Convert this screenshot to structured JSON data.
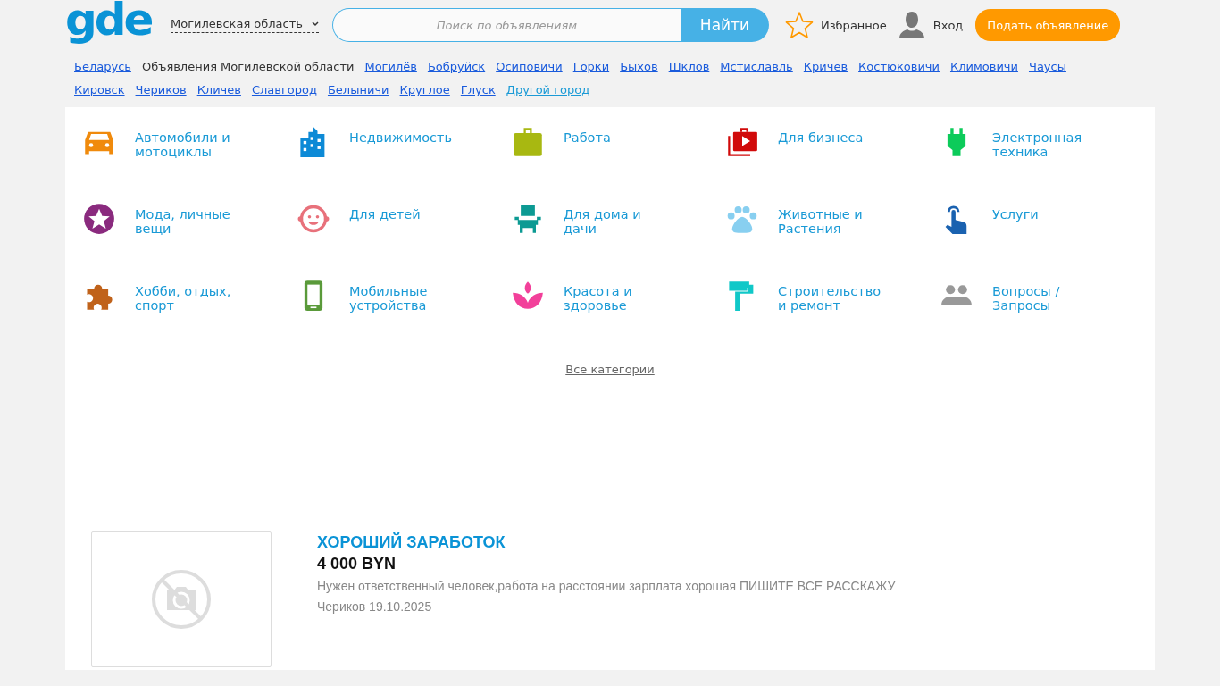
{
  "header": {
    "logo": "gde",
    "region": "Могилевская область",
    "search": {
      "placeholder": "Поиск по объявлениям",
      "button": "Найти"
    },
    "favorites": "Избранное",
    "login": "Вход",
    "post_button": "Подать объявление"
  },
  "breadcrumbs": [
    {
      "label": "Беларусь",
      "kind": "link"
    },
    {
      "label": "Объявления Могилевской области",
      "kind": "current"
    },
    {
      "label": "Могилёв",
      "kind": "link"
    },
    {
      "label": "Бобруйск",
      "kind": "link"
    },
    {
      "label": "Осиповичи",
      "kind": "link"
    },
    {
      "label": "Горки",
      "kind": "link"
    },
    {
      "label": "Быхов",
      "kind": "link"
    },
    {
      "label": "Шклов",
      "kind": "link"
    },
    {
      "label": "Мстиславль",
      "kind": "link"
    },
    {
      "label": "Кричев",
      "kind": "link"
    },
    {
      "label": "Костюковичи",
      "kind": "link"
    },
    {
      "label": "Климовичи",
      "kind": "link"
    },
    {
      "label": "Чаусы",
      "kind": "link"
    },
    {
      "label": "Кировск",
      "kind": "link"
    },
    {
      "label": "Чериков",
      "kind": "link"
    },
    {
      "label": "Кличев",
      "kind": "link"
    },
    {
      "label": "Славгород",
      "kind": "link"
    },
    {
      "label": "Белыничи",
      "kind": "link"
    },
    {
      "label": "Круглое",
      "kind": "link"
    },
    {
      "label": "Глуск",
      "kind": "link"
    },
    {
      "label": "Другой город",
      "kind": "other"
    }
  ],
  "categories": [
    {
      "label": "Автомобили и мотоциклы",
      "kind": "car",
      "color": "#f08a0c"
    },
    {
      "label": "Недвижимость",
      "kind": "building",
      "color": "#0d8ad6"
    },
    {
      "label": "Работа",
      "kind": "briefcase",
      "color": "#a8b811"
    },
    {
      "label": "Для бизнеса",
      "kind": "business",
      "color": "#d10a0a"
    },
    {
      "label": "Электронная техника",
      "kind": "plug",
      "color": "#0ccb5a"
    },
    {
      "label": "Мода, личные вещи",
      "kind": "star",
      "color": "#8a2a7e"
    },
    {
      "label": "Для детей",
      "kind": "baby",
      "color": "#e8717b"
    },
    {
      "label": "Для дома и дачи",
      "kind": "chair",
      "color": "#0c9a93"
    },
    {
      "label": "Животные и Растения",
      "kind": "paw",
      "color": "#88cff0"
    },
    {
      "label": "Услуги",
      "kind": "hand",
      "color": "#1a62b0"
    },
    {
      "label": "Хобби, отдых, спорт",
      "kind": "puzzle",
      "color": "#c0621a"
    },
    {
      "label": "Мобильные устройства",
      "kind": "phone",
      "color": "#5a9a3a"
    },
    {
      "label": "Красота и здоровье",
      "kind": "lotus",
      "color": "#f2409a"
    },
    {
      "label": "Строительство и ремонт",
      "kind": "roller",
      "color": "#10c8c8"
    },
    {
      "label": "Вопросы / Запросы",
      "kind": "people",
      "color": "#999999"
    }
  ],
  "all_categories": "Все категории",
  "listings": [
    {
      "title": "ХОРОШИЙ ЗАРАБОТОК",
      "price": "4 000 BYN",
      "description": "Нужен ответственный человек,работа на расстоянии зарплата хорошая ПИШИТЕ ВСЕ РАССКАЖУ",
      "meta": "Чериков 19.10.2025"
    }
  ]
}
